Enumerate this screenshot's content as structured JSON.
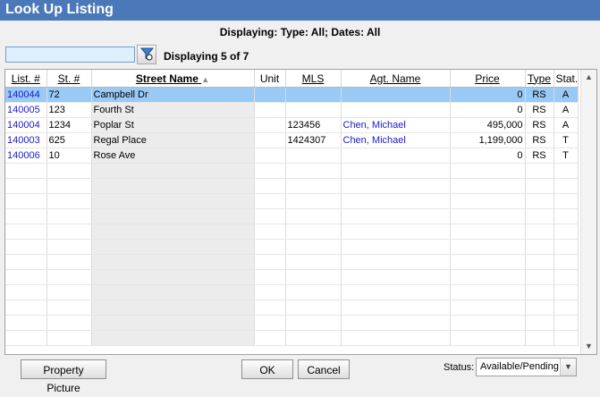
{
  "window": {
    "title": "Look Up Listing"
  },
  "filter": {
    "info": "Displaying: Type: All; Dates: All"
  },
  "search": {
    "value": "",
    "placeholder": ""
  },
  "display_count": "Displaying 5 of 7",
  "columns": [
    "List. #",
    "St. #",
    "Street Name",
    "Unit",
    "MLS",
    "Agt. Name",
    "Price",
    "Type",
    "Stat."
  ],
  "sort_icon": "sort-ascending-icon",
  "rows": [
    {
      "list_no": "140044",
      "st_no": "72",
      "street": "Campbell Dr",
      "unit": "",
      "mls": "",
      "agent": "",
      "price": "0",
      "type": "RS",
      "status": "A",
      "selected": true
    },
    {
      "list_no": "140005",
      "st_no": "123",
      "street": "Fourth St",
      "unit": "",
      "mls": "",
      "agent": "",
      "price": "0",
      "type": "RS",
      "status": "A",
      "selected": false
    },
    {
      "list_no": "140004",
      "st_no": "1234",
      "street": "Poplar St",
      "unit": "",
      "mls": "123456",
      "agent": "Chen, Michael",
      "price": "495,000",
      "type": "RS",
      "status": "A",
      "selected": false
    },
    {
      "list_no": "140003",
      "st_no": "625",
      "street": "Regal Place",
      "unit": "",
      "mls": "1424307",
      "agent": "Chen, Michael",
      "price": "1,199,000",
      "type": "RS",
      "status": "T",
      "selected": false
    },
    {
      "list_no": "140006",
      "st_no": "10",
      "street": "Rose Ave",
      "unit": "",
      "mls": "",
      "agent": "",
      "price": "0",
      "type": "RS",
      "status": "T",
      "selected": false
    }
  ],
  "buttons": {
    "property_picture": "Property Picture",
    "ok": "OK",
    "cancel": "Cancel"
  },
  "status": {
    "label": "Status:",
    "value": "Available/Pending"
  },
  "colors": {
    "title_bar": "#4a78b8",
    "selected_row": "#99c9f5",
    "link": "#1a1acc"
  }
}
